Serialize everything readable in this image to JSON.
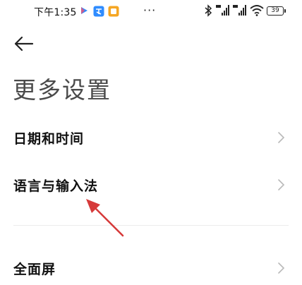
{
  "status_bar": {
    "time": "下午1:35",
    "more_indicator": "···",
    "battery": "39"
  },
  "header": {
    "back_label": "←",
    "title": "更多设置"
  },
  "settings_list": [
    {
      "label": "日期和时间"
    },
    {
      "label": "语言与输入法"
    },
    {
      "label": "全面屏"
    }
  ],
  "colors": {
    "annotation_arrow": "#d63a3a",
    "app_icon_blue": "#2f8cff",
    "app_icon_orange": "#f5a623",
    "chevron": "#b9b9b9"
  }
}
